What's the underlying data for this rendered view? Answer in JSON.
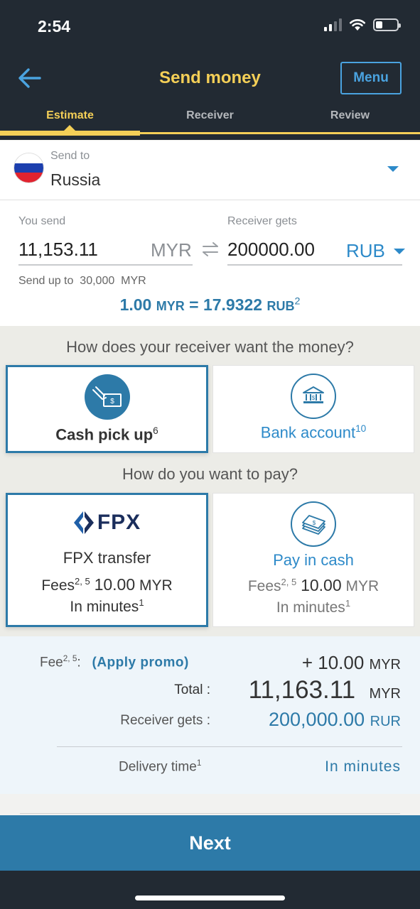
{
  "status_bar": {
    "time": "2:54"
  },
  "header": {
    "title": "Send money",
    "menu_label": "Menu"
  },
  "tabs": [
    {
      "label": "Estimate",
      "active": true
    },
    {
      "label": "Receiver",
      "active": false
    },
    {
      "label": "Review",
      "active": false
    }
  ],
  "country": {
    "label": "Send to",
    "name": "Russia"
  },
  "amounts": {
    "send_label": "You send",
    "send_value": "11,153.11",
    "send_currency": "MYR",
    "receive_label": "Receiver gets",
    "receive_value": "200000.00",
    "receive_currency": "RUB",
    "limit_label": "Send up to",
    "limit_value": "30,000",
    "limit_currency": "MYR"
  },
  "rate": {
    "from_amount": "1.00",
    "from_ccy": "MYR",
    "equals": "=",
    "to_amount": "17.9322",
    "to_ccy": "RUB",
    "sup": "2"
  },
  "receive_method": {
    "question": "How does your receiver want the money?",
    "options": [
      {
        "label": "Cash pick up",
        "sup": "6",
        "selected": true
      },
      {
        "label": "Bank account",
        "sup": "10",
        "selected": false
      }
    ]
  },
  "pay_method": {
    "question": "How do you want to pay?",
    "options": [
      {
        "logo": "FPX",
        "label": "FPX transfer",
        "fees_label": "Fees",
        "fees_sup": "2, 5",
        "fees_amount": "10.00",
        "fees_ccy": "MYR",
        "time_label": "In minutes",
        "time_sup": "1",
        "selected": true
      },
      {
        "label": "Pay in cash",
        "fees_label": "Fees",
        "fees_sup": "2, 5",
        "fees_amount": "10.00",
        "fees_ccy": "MYR",
        "time_label": "In minutes",
        "time_sup": "1",
        "selected": false
      }
    ]
  },
  "summary": {
    "fee_label": "Fee",
    "fee_sup": "2, 5",
    "fee_colon": ":",
    "promo_label": "(Apply promo)",
    "fee_value": "+ 10.00",
    "fee_ccy": "MYR",
    "total_label": "Total :",
    "total_value": "11,163.11",
    "total_ccy": "MYR",
    "receiver_label": "Receiver gets :",
    "receiver_value": "200,000.00",
    "receiver_ccy": "RUR",
    "delivery_label": "Delivery time",
    "delivery_sup": "1",
    "delivery_value": "In minutes"
  },
  "next_label": "Next",
  "colors": {
    "header_bg": "#222a33",
    "accent_yellow": "#f4cf57",
    "primary_blue": "#2d7aa8",
    "link_blue": "#2d8ac9"
  },
  "icons": [
    "back-arrow-icon",
    "wifi-icon",
    "battery-icon",
    "cellular-signal-icon",
    "russia-flag-icon",
    "swap-icon",
    "cash-pickup-icon",
    "bank-icon",
    "fpx-logo-icon",
    "cash-stack-icon",
    "dropdown-caret-icon"
  ]
}
